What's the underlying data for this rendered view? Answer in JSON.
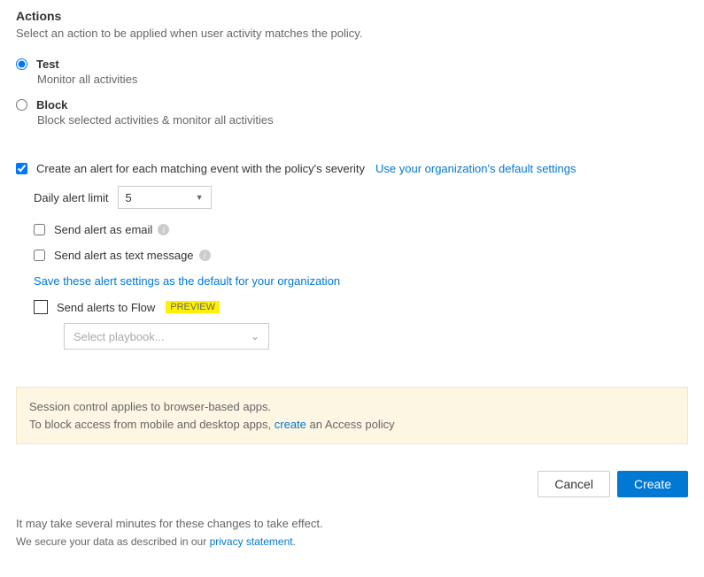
{
  "section": {
    "title": "Actions",
    "description": "Select an action to be applied when user activity matches the policy."
  },
  "radios": {
    "test": {
      "label": "Test",
      "sub": "Monitor all activities"
    },
    "block": {
      "label": "Block",
      "sub": "Block selected activities & monitor all activities"
    }
  },
  "alert": {
    "label": "Create an alert for each matching event with the policy's severity",
    "defaults_link": "Use your organization's default settings",
    "limit_label": "Daily alert limit",
    "limit_value": "5",
    "email_label": "Send alert as email",
    "sms_label": "Send alert as text message",
    "save_link": "Save these alert settings as the default for your organization",
    "flow_label": "Send alerts to Flow",
    "preview_badge": "PREVIEW",
    "playbook_placeholder": "Select playbook..."
  },
  "notice": {
    "line1": "Session control applies to browser-based apps.",
    "line2a": "To block access from mobile and desktop apps, ",
    "line2_link": "create",
    "line2b": " an Access policy"
  },
  "buttons": {
    "cancel": "Cancel",
    "create": "Create"
  },
  "footer": {
    "line1": "It may take several minutes for these changes to take effect.",
    "line2a": "We secure your data as described in our ",
    "privacy_link": "privacy statement",
    "line2b": "."
  }
}
